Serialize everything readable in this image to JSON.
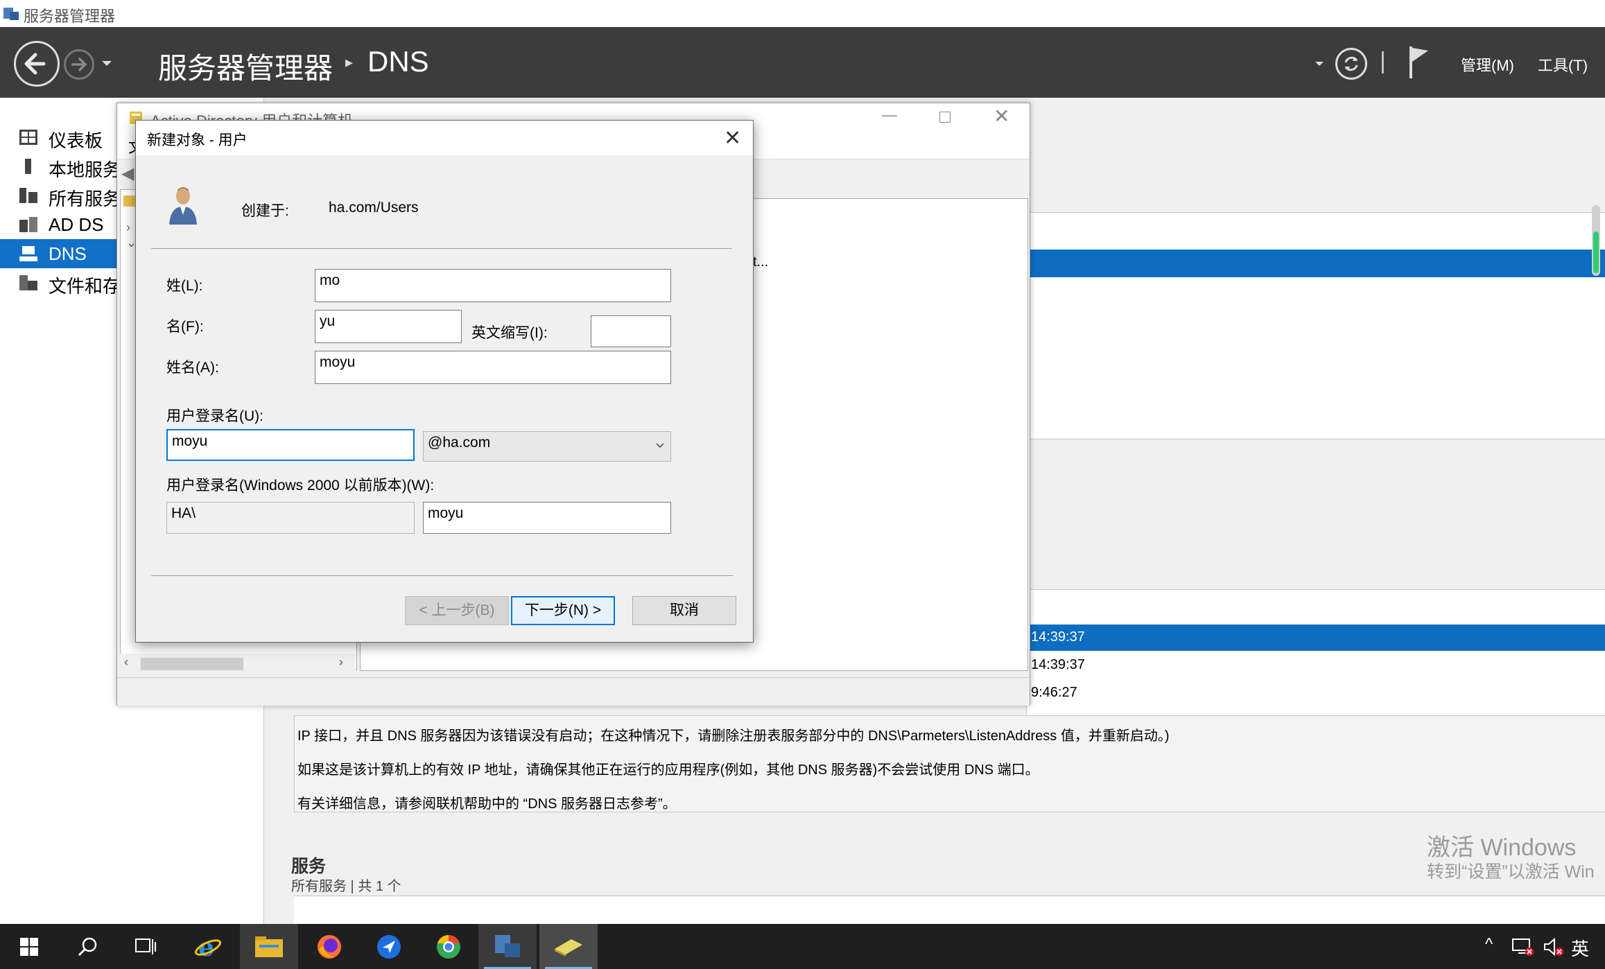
{
  "window": {
    "title": "服务器管理器"
  },
  "header": {
    "breadcrumb_root": "服务器管理器",
    "breadcrumb_sep": "▸",
    "breadcrumb_page": "DNS",
    "menu_manage": "管理(M)",
    "menu_tools": "工具(T)",
    "menu_divider": "|"
  },
  "sidebar": {
    "items": [
      {
        "label": "仪表板"
      },
      {
        "label": "本地服务"
      },
      {
        "label": "所有服务"
      },
      {
        "label": "AD DS"
      },
      {
        "label": "DNS"
      },
      {
        "label": "文件和存"
      }
    ]
  },
  "aduc": {
    "title": "Active Directory 用户和计算机",
    "menu_fragment": "文",
    "list_fragment": "t..."
  },
  "events": {
    "rows": [
      {
        "time": "14:39:37"
      },
      {
        "time": "14:39:37"
      },
      {
        "time": "9:46:27"
      }
    ],
    "details": [
      "IP 接口，并且 DNS 服务器因为该错误没有启动；在这种情况下，请删除注册表服务部分中的 DNS\\Parmeters\\ListenAddress 值，并重新启动。)",
      "如果这是该计算机上的有效 IP 地址，请确保其他正在运行的应用程序(例如，其他 DNS 服务器)不会尝试使用 DNS 端口。",
      "有关详细信息，请参阅联机帮助中的 “DNS 服务器日志参考”。"
    ]
  },
  "services": {
    "heading": "服务",
    "subtitle": "所有服务 | 共 1 个"
  },
  "dialog": {
    "title": "新建对象 - 用户",
    "create_in_label": "创建于:",
    "create_in_value": "ha.com/Users",
    "last_name_label": "姓(L):",
    "last_name_value": "mo",
    "first_name_label": "名(F):",
    "first_name_value": "yu",
    "initials_label": "英文缩写(I):",
    "initials_value": "",
    "full_name_label": "姓名(A):",
    "full_name_value": "moyu",
    "logon_label": "用户登录名(U):",
    "logon_value": "moyu",
    "domain_value": "@ha.com",
    "pre2000_label": "用户登录名(Windows 2000 以前版本)(W):",
    "pre2000_domain": "HA\\",
    "pre2000_value": "moyu",
    "back_button": "< 上一步(B)",
    "next_button": "下一步(N) >",
    "cancel_button": "取消"
  },
  "watermark": {
    "line1": "激活 Windows",
    "line2": "转到“设置”以激活 Win"
  },
  "tray": {
    "ime": "英"
  },
  "colors": {
    "accent": "#0c6dc1",
    "header": "#3c3c3c",
    "taskbar": "#1f1f1f"
  }
}
